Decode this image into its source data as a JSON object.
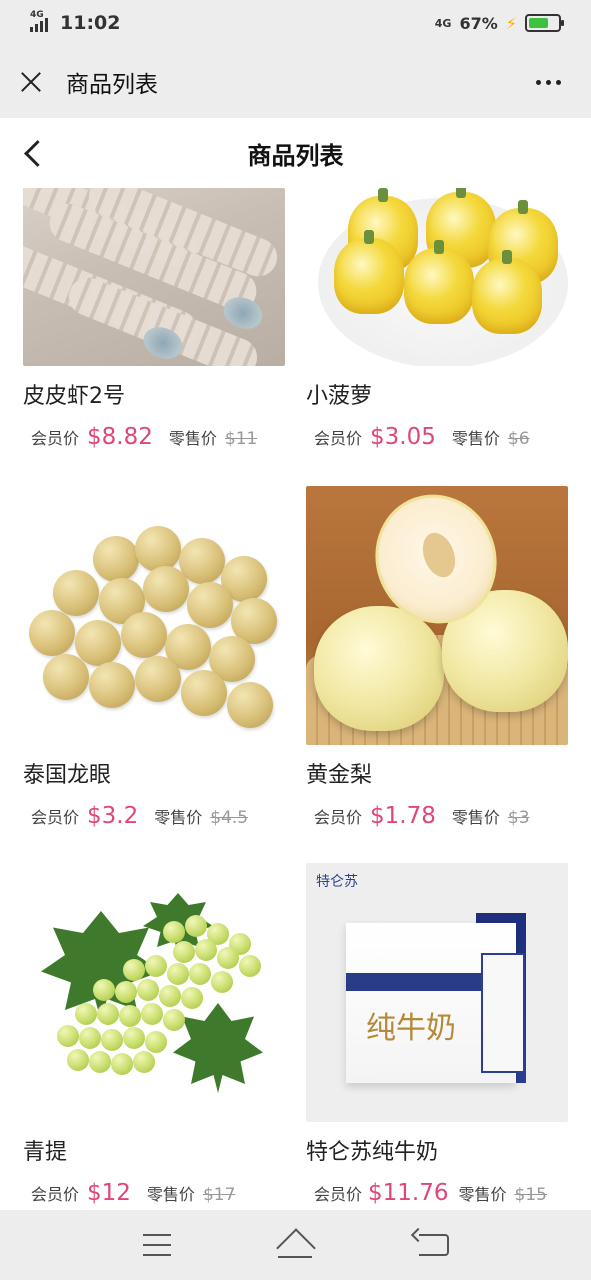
{
  "status_bar": {
    "network": "4G",
    "time": "11:02",
    "network_right": "4G",
    "battery": "67%",
    "battery_level": 0.67
  },
  "wechat_bar": {
    "title": "商品列表"
  },
  "page_header": {
    "title": "商品列表"
  },
  "member_label": "会员价",
  "retail_label": "零售价",
  "products": [
    {
      "name": "皮皮虾2号",
      "member_price": "$8.82",
      "retail_price": "$11",
      "image": "mantis-shrimp"
    },
    {
      "name": "小菠萝",
      "member_price": "$3.05",
      "retail_price": "$6",
      "image": "mini-pineapple"
    },
    {
      "name": "泰国龙眼",
      "member_price": "$3.2",
      "retail_price": "$4.5",
      "image": "longan"
    },
    {
      "name": "黄金梨",
      "member_price": "$1.78",
      "retail_price": "$3",
      "image": "golden-pear"
    },
    {
      "name": "青提",
      "member_price": "$12",
      "retail_price": "$17",
      "image": "green-grapes"
    },
    {
      "name": "特仑苏纯牛奶",
      "member_price": "$11.76",
      "retail_price": "$15",
      "image": "milk-box"
    }
  ],
  "milk_image": {
    "brand": "特仑苏",
    "text": "纯牛奶"
  },
  "colors": {
    "member_price": "#e0467a",
    "retail_price": "#999999",
    "bars": "#ededed"
  }
}
